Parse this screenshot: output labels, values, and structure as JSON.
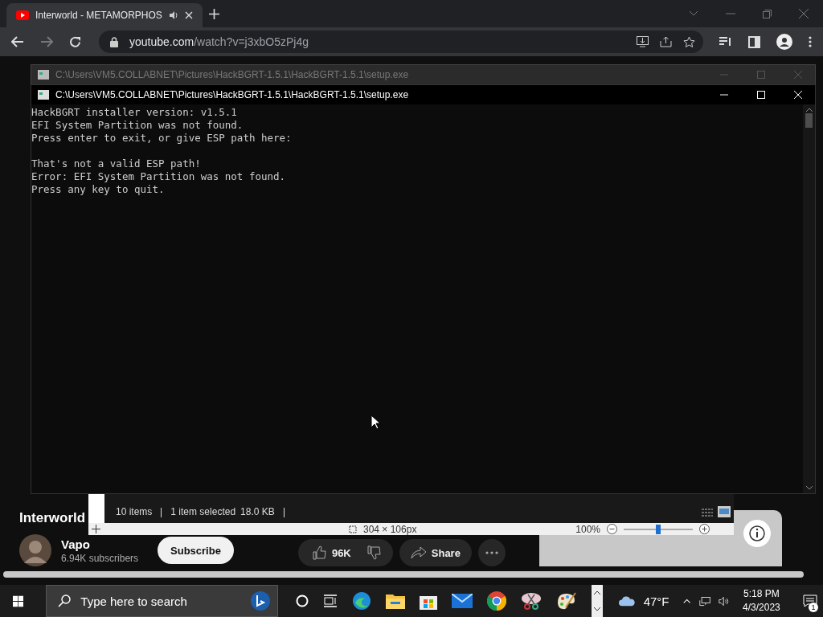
{
  "browser": {
    "tab": {
      "title": "Interworld - METAMORPHOS",
      "audio": true
    },
    "url_host": "youtube.com",
    "url_path": "/watch?v=j3xbO5zPj4g"
  },
  "video": {
    "title": "Interworld",
    "channel": "Vapo",
    "subscribers": "6.94K subscribers",
    "subscribe": "Subscribe",
    "likes": "96K",
    "share": "Share"
  },
  "console_back": {
    "title": "C:\\Users\\VM5.COLLABNET\\Pictures\\HackBGRT-1.5.1\\HackBGRT-1.5.1\\setup.exe"
  },
  "console": {
    "title": "C:\\Users\\VM5.COLLABNET\\Pictures\\HackBGRT-1.5.1\\HackBGRT-1.5.1\\setup.exe",
    "paragraphs": [
      [
        "HackBGRT installer version: v1.5.1",
        "EFI System Partition was not found.",
        "Press enter to exit, or give ESP path here:"
      ],
      [
        "That's not a valid ESP path!",
        "Error: EFI System Partition was not found.",
        "Press any key to quit."
      ]
    ]
  },
  "explorer": {
    "items": "10 items",
    "selected": "1 item selected",
    "size": "18.0 KB"
  },
  "paint": {
    "dimensions": "304 × 106px",
    "zoom": "100%",
    "level": 0.5
  },
  "taskbar": {
    "search_placeholder": "Type here to search",
    "apps": [
      {
        "kind": "cortana"
      },
      {
        "kind": "taskview"
      },
      {
        "kind": "edge"
      },
      {
        "kind": "folder"
      },
      {
        "kind": "store"
      },
      {
        "kind": "mail"
      },
      {
        "kind": "chrome"
      },
      {
        "kind": "snip"
      },
      {
        "kind": "paint"
      }
    ],
    "weather": "47°F",
    "time": "5:18 PM",
    "date": "4/3/2023",
    "notifications": "1"
  }
}
